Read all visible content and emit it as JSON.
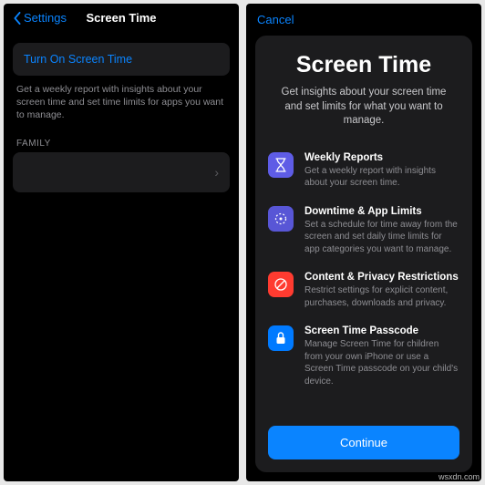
{
  "left": {
    "nav": {
      "back": "Settings",
      "title": "Screen Time"
    },
    "turn_on": "Turn On Screen Time",
    "desc": "Get a weekly report with insights about your screen time and set time limits for apps you want to manage.",
    "family_label": "FAMILY"
  },
  "right": {
    "cancel": "Cancel",
    "title": "Screen Time",
    "sub": "Get insights about your screen time and set limits for what you want to manage.",
    "features": [
      {
        "title": "Weekly Reports",
        "body": "Get a weekly report with insights about your screen time."
      },
      {
        "title": "Downtime & App Limits",
        "body": "Set a schedule for time away from the screen and set daily time limits for app categories you want to manage."
      },
      {
        "title": "Content & Privacy Restrictions",
        "body": "Restrict settings for explicit content, purchases, downloads and privacy."
      },
      {
        "title": "Screen Time Passcode",
        "body": "Manage Screen Time for children from your own iPhone or use a Screen Time passcode on your child's device."
      }
    ],
    "continue": "Continue"
  },
  "watermark": "wsxdn.com"
}
